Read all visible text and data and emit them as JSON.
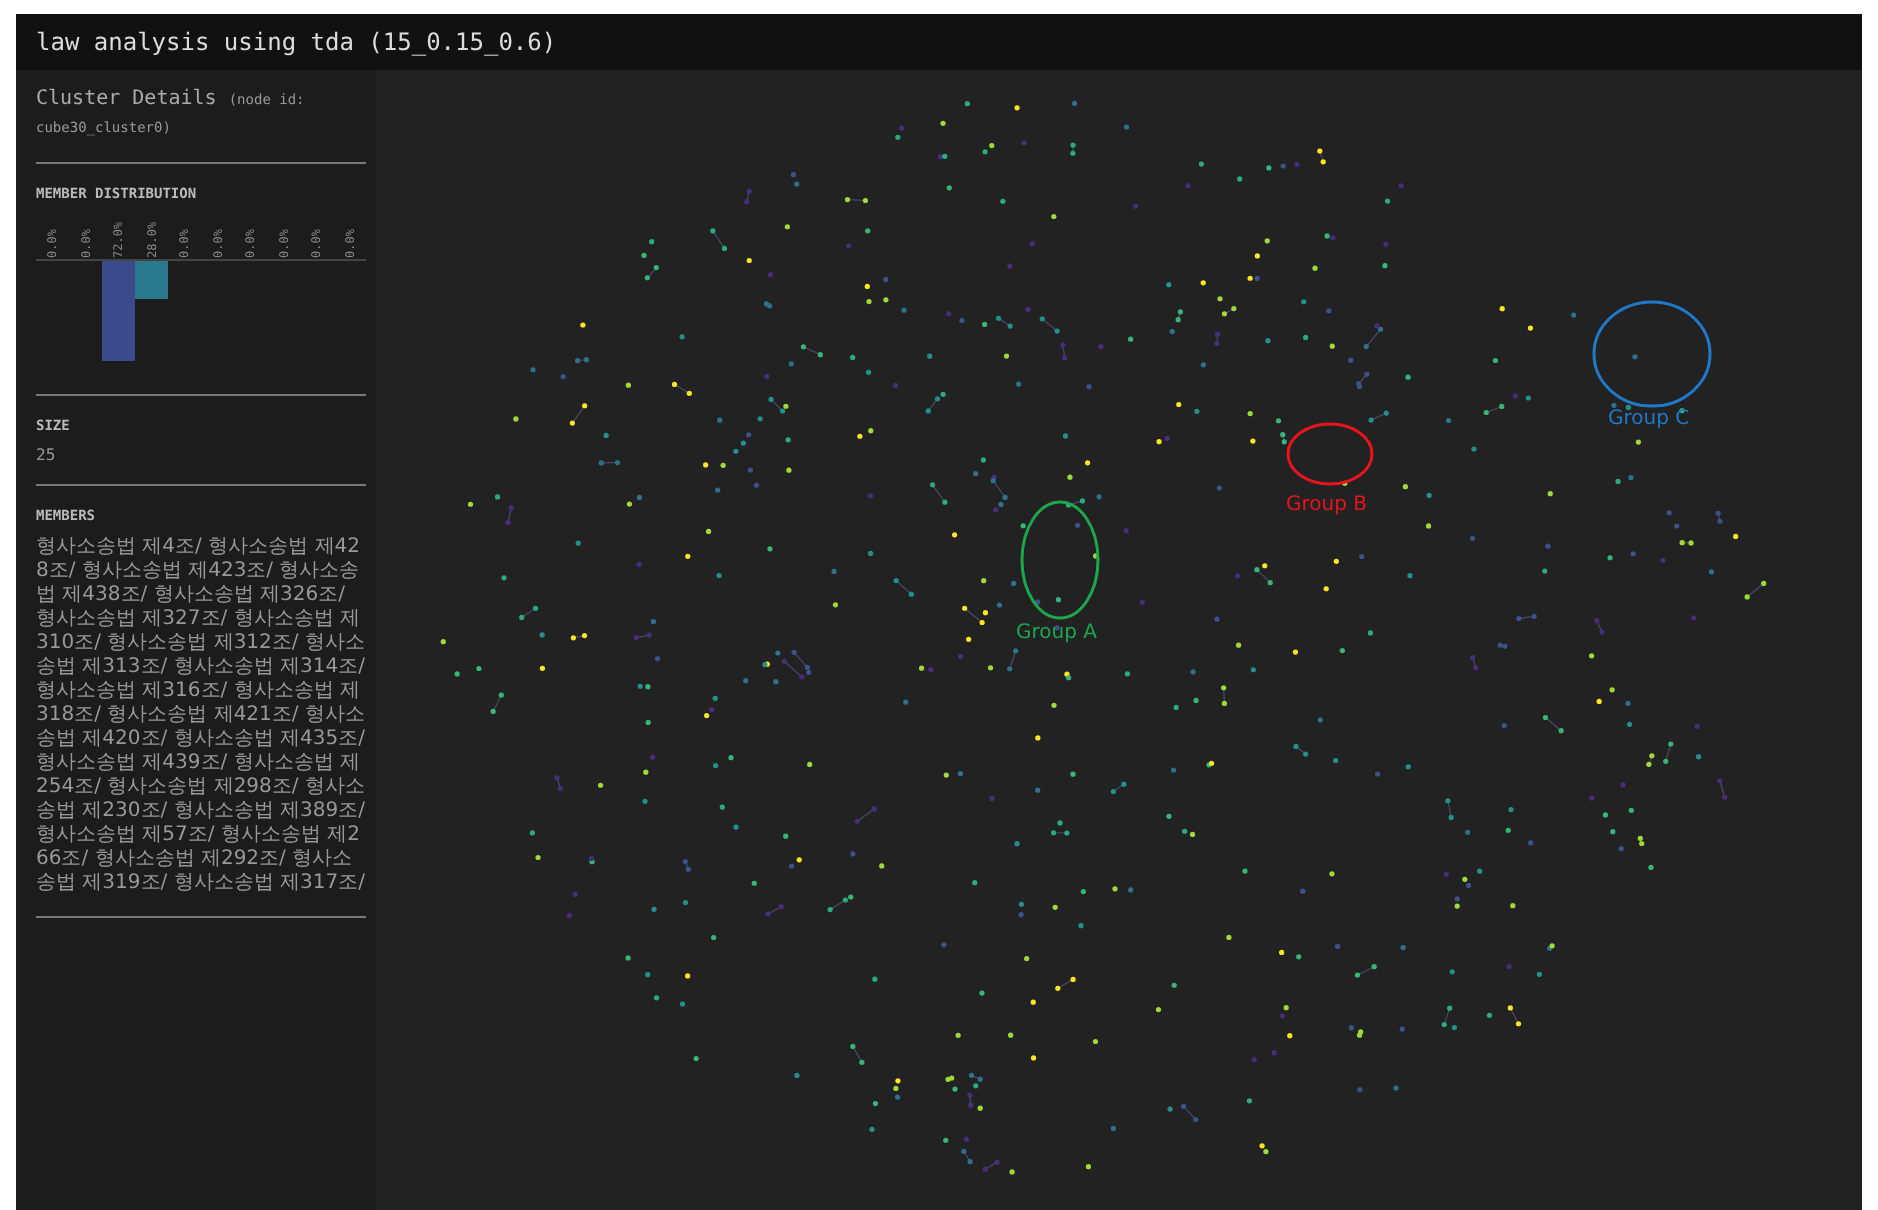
{
  "window": {
    "title": "law analysis using tda (15_0.15_0.6)"
  },
  "sidebar": {
    "title": "Cluster Details",
    "node_id": "(node id: cube30_cluster0)",
    "distribution": {
      "heading": "MEMBER DISTRIBUTION",
      "bars": [
        {
          "label": "0.0%"
        },
        {
          "label": "0.0%"
        },
        {
          "label": "72.0%"
        },
        {
          "label": "28.0%"
        },
        {
          "label": "0.0%"
        },
        {
          "label": "0.0%"
        },
        {
          "label": "0.0%"
        },
        {
          "label": "0.0%"
        },
        {
          "label": "0.0%"
        },
        {
          "label": "0.0%"
        }
      ]
    },
    "size": {
      "heading": "SIZE",
      "value": "25"
    },
    "members": {
      "heading": "MEMBERS",
      "text": "형사소송법 제4조/ 형사소송법 제428조/ 형사소송법 제423조/ 형사소송법 제438조/ 형사소송법 제326조/ 형사소송법 제327조/ 형사소송법 제310조/ 형사소송법 제312조/ 형사소송법 제313조/ 형사소송법 제314조/ 형사소송법 제316조/ 형사소송법 제318조/ 형사소송법 제421조/ 형사소송법 제420조/ 형사소송법 제435조/ 형사소송법 제439조/ 형사소송법 제254조/ 형사소송법 제298조/ 형사소송법 제230조/ 형사소송법 제389조/ 형사소송법 제57조/ 형사소송법 제266조/ 형사소송법 제292조/ 형사소송법 제319조/ 형사소송법 제317조/"
    }
  },
  "graph": {
    "groups": [
      {
        "label": "Group A",
        "color": "#1ba84c"
      },
      {
        "label": "Group B",
        "color": "#e8141c"
      },
      {
        "label": "Group C",
        "color": "#1f78c8"
      }
    ]
  }
}
